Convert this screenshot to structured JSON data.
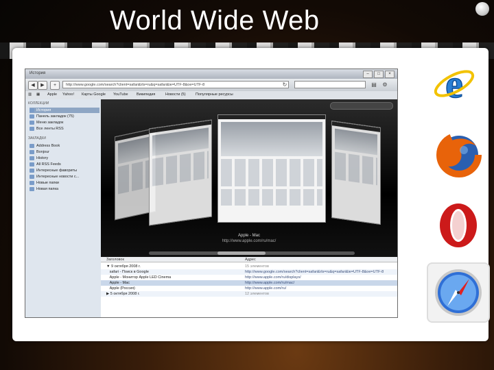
{
  "slide": {
    "title": "World Wide Web"
  },
  "window": {
    "title": "История",
    "buttons": [
      "–",
      "□",
      "×"
    ],
    "toolbar": {
      "url": "http://www.google.com/search?client=safari&rls=ru&q=safari&ie=UTF-8&oe=UTF-8",
      "search_value": ""
    },
    "bookmarks_bar": [
      "Apple",
      "Yahoo!",
      "Карты Google",
      "YouTube",
      "Википедия",
      "Новости (5)",
      "Популярные ресурсы"
    ],
    "sidebar": {
      "section1": "КОЛЛЕКЦИИ",
      "collections": [
        "История",
        "Панель закладок (75)",
        "Меню закладок",
        "Все ленты RSS"
      ],
      "section2": "ЗАКЛАДКИ",
      "bookmarks": [
        "Address Book",
        "Bonjour",
        "History",
        "All RSS Feeds",
        "Интересные фавориты",
        "Интересные новости с...",
        "Новые папки",
        "Новая папка"
      ]
    },
    "coverflow": {
      "caption_title": "Apple - Mac",
      "caption_url": "http://www.apple.com/ru/mac/"
    },
    "table": {
      "col1": "Заголовок",
      "col2": "Адрес",
      "rows": [
        {
          "title": "9 октября 2008 г.",
          "url": "15 элементов",
          "kind": "group"
        },
        {
          "title": "safari - Поиск в Google",
          "url": "http://www.google.com/search?client=safari&rls=ru&q=safari&ie=UTF-8&oe=UTF-8",
          "kind": "item"
        },
        {
          "title": "Apple - Монитор Apple LED Cinema",
          "url": "http://www.apple.com/ru/displays/",
          "kind": "item"
        },
        {
          "title": "Apple - Mac",
          "url": "http://www.apple.com/ru/mac/",
          "kind": "selected"
        },
        {
          "title": "Apple (Россия)",
          "url": "http://www.apple.com/ru/",
          "kind": "item"
        },
        {
          "title": "5 октября 2008 г.",
          "url": "12 элементов",
          "kind": "group"
        }
      ]
    }
  },
  "icons": {
    "browsers": [
      "internet-explorer-logo",
      "firefox-logo",
      "opera-logo",
      "safari-logo"
    ],
    "colors": {
      "ie_blue": "#2a7fd4",
      "firefox_orange": "#e8630a",
      "opera_red": "#cc1a1a",
      "safari_blue": "#2f6fd6"
    }
  }
}
